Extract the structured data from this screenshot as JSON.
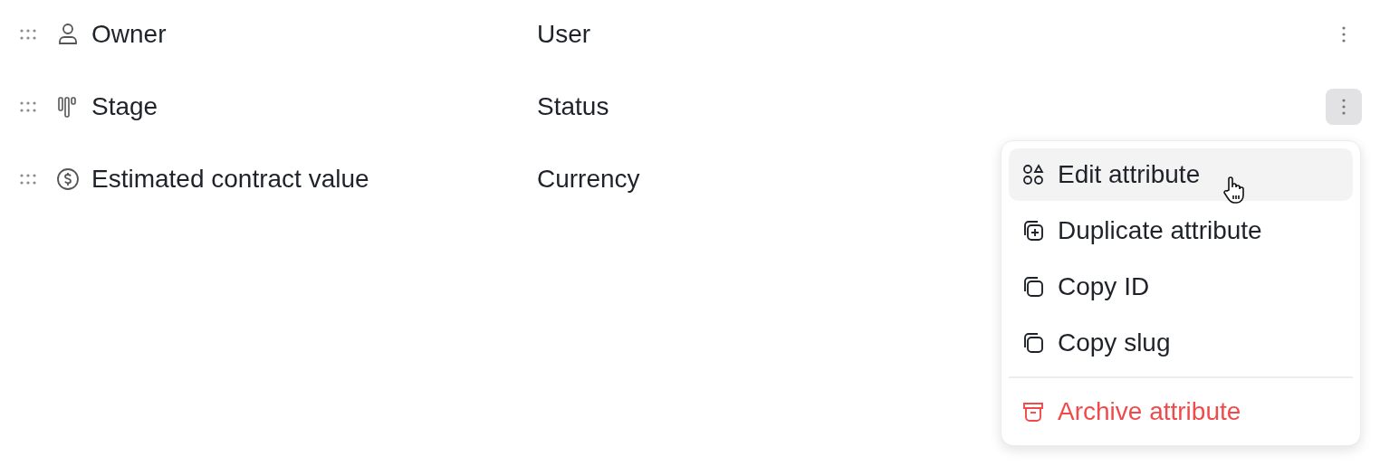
{
  "attributes": [
    {
      "name": "Owner",
      "type": "User",
      "kind": "person",
      "menu_open": false
    },
    {
      "name": "Stage",
      "type": "Status",
      "kind": "stage",
      "menu_open": true
    },
    {
      "name": "Estimated contract value",
      "type": "Currency",
      "kind": "currency"
    }
  ],
  "menu": {
    "items": [
      {
        "label": "Edit attribute",
        "kind": "edit",
        "selected": true
      },
      {
        "label": "Duplicate attribute",
        "kind": "duplicate",
        "selected": false
      },
      {
        "label": "Copy ID",
        "kind": "copy",
        "selected": false
      },
      {
        "label": "Copy slug",
        "kind": "copy",
        "selected": false
      },
      {
        "label": "Archive attribute",
        "kind": "danger",
        "selected": false
      }
    ]
  }
}
